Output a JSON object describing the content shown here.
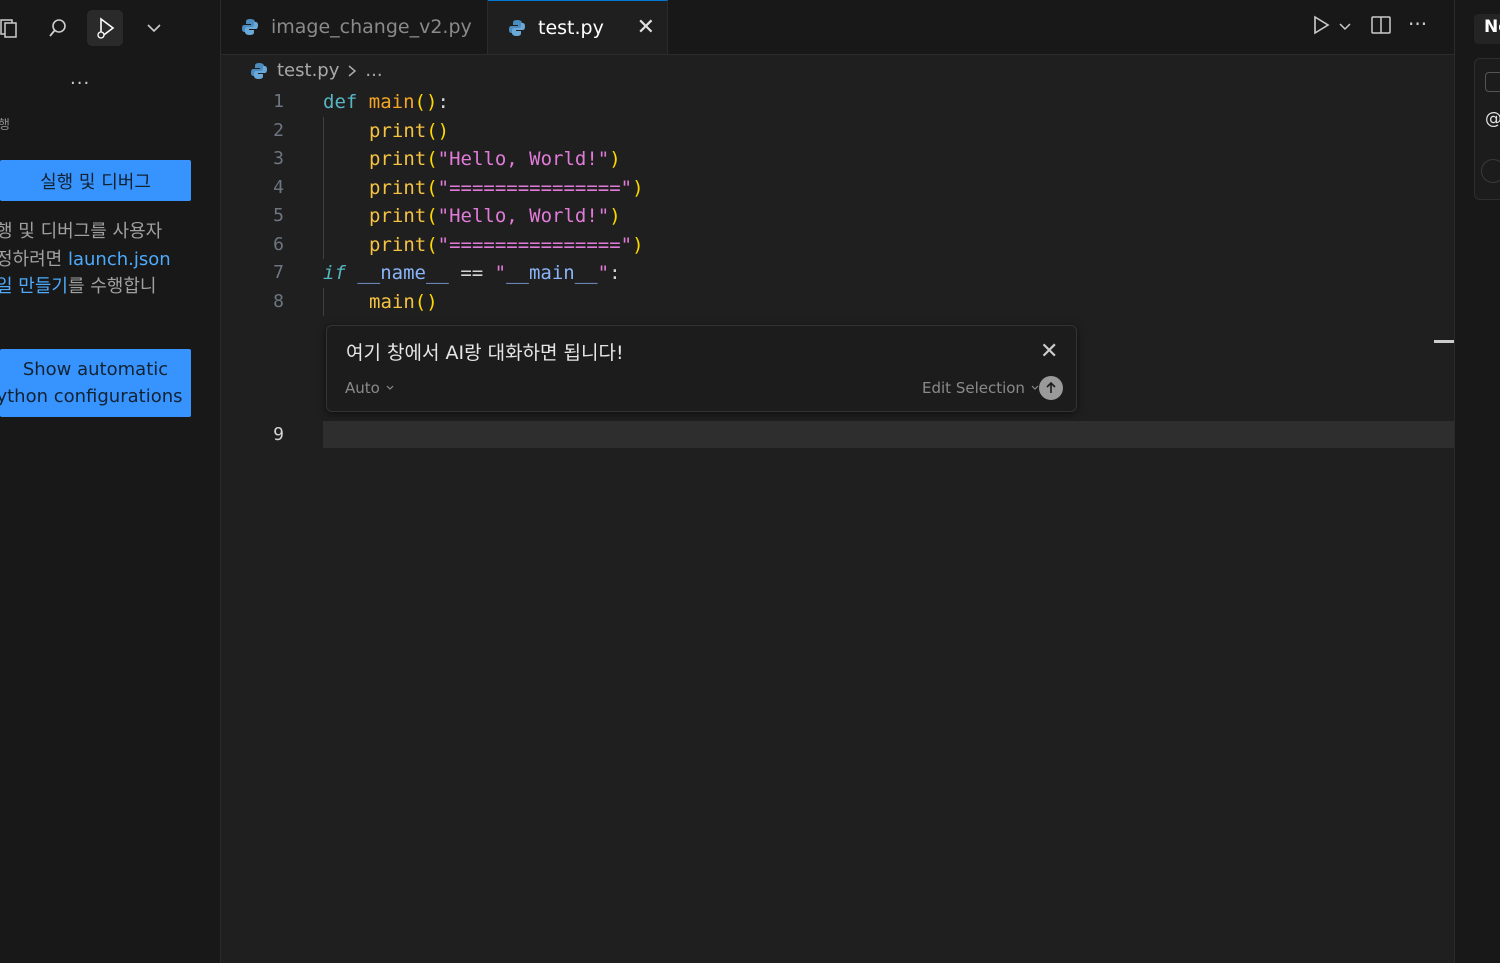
{
  "sidebar": {
    "section_title": "행",
    "run_debug_button": "실행 및 디버그",
    "help_line1": "행 및 디버그를 사용자",
    "help_line2_prefix": "정하려면 ",
    "help_link1": "launch.json",
    "help_line3_link": "일 만들기",
    "help_line3_suffix": "를 수행합니",
    "show_config_line1": "Show automatic",
    "show_config_line2": "ython configurations",
    "more": "..."
  },
  "tabs": [
    {
      "label": "image_change_v2.py",
      "active": false
    },
    {
      "label": "test.py",
      "active": true
    }
  ],
  "breadcrumb": {
    "file": "test.py",
    "rest": "..."
  },
  "code": {
    "line_numbers": [
      "1",
      "2",
      "3",
      "4",
      "5",
      "6",
      "7",
      "8",
      "9"
    ],
    "l1_def": "def",
    "l1_fn": "main",
    "l1_parens": "()",
    "l1_colon": ":",
    "l2_fn": "print",
    "l2_args": "()",
    "l3_fn": "print",
    "l3_str": "\"Hello, World!\"",
    "l4_fn": "print",
    "l4_str": "\"===============\"",
    "l5_fn": "print",
    "l5_str": "\"Hello, World!\"",
    "l6_fn": "print",
    "l6_str": "\"===============\"",
    "l7_if": "if",
    "l7_name": "__name__",
    "l7_eq": "==",
    "l7_q1": "\"",
    "l7_main": "__main__",
    "l7_q2": "\"",
    "l7_colon": ":",
    "l8_fn": "main",
    "l8_args": "()"
  },
  "ai_widget": {
    "prompt_text": "여기 창에서 AI랑 대화하면 됩니다!",
    "mode": "Auto",
    "edit_selection": "Edit Selection"
  },
  "right_panel": {
    "label": "Ne",
    "item": "@"
  },
  "colors": {
    "accent": "#3794ff",
    "editor_bg": "#1f1f1f",
    "sidebar_bg": "#181818"
  }
}
